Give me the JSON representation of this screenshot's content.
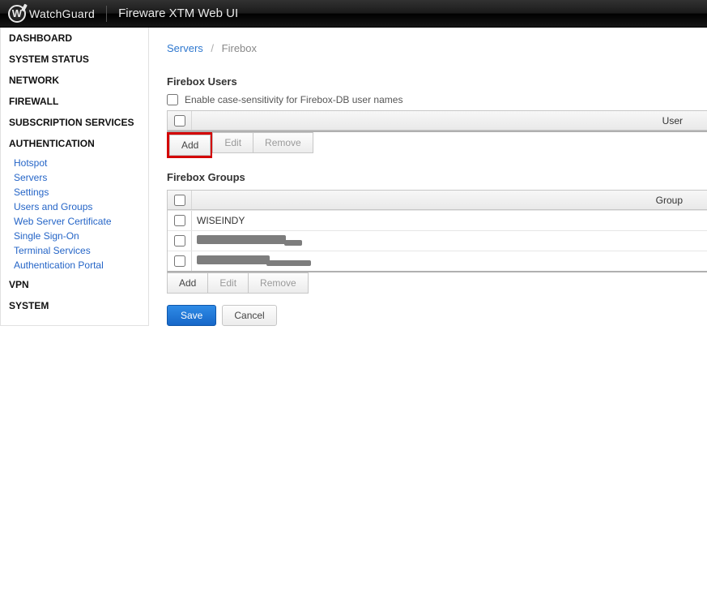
{
  "header": {
    "brand": "WatchGuard",
    "app_title": "Fireware XTM Web UI"
  },
  "sidebar": {
    "sections": [
      {
        "label": "DASHBOARD"
      },
      {
        "label": "SYSTEM STATUS"
      },
      {
        "label": "NETWORK"
      },
      {
        "label": "FIREWALL"
      },
      {
        "label": "SUBSCRIPTION SERVICES"
      },
      {
        "label": "AUTHENTICATION",
        "expanded": true,
        "items": [
          "Hotspot",
          "Servers",
          "Settings",
          "Users and Groups",
          "Web Server Certificate",
          "Single Sign-On",
          "Terminal Services",
          "Authentication Portal"
        ]
      },
      {
        "label": "VPN"
      },
      {
        "label": "SYSTEM"
      }
    ]
  },
  "breadcrumb": {
    "parent": "Servers",
    "current": "Firebox"
  },
  "users": {
    "title": "Firebox Users",
    "case_label": "Enable case-sensitivity for Firebox-DB user names",
    "column": "User",
    "buttons": {
      "add": "Add",
      "edit": "Edit",
      "remove": "Remove"
    }
  },
  "groups": {
    "title": "Firebox Groups",
    "column": "Group",
    "rows": [
      "WISEINDY",
      "",
      ""
    ],
    "buttons": {
      "add": "Add",
      "edit": "Edit",
      "remove": "Remove"
    }
  },
  "footer": {
    "save": "Save",
    "cancel": "Cancel"
  }
}
